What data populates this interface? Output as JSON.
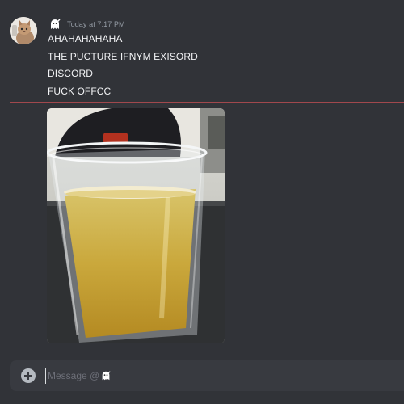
{
  "message": {
    "author_icon": "ghost-emoji-icon",
    "timestamp": "Today at 7:17 PM",
    "lines": [
      "AHAHAHAHAHA",
      "THE PUCTURE IFNYM EXISORD",
      "DISCORD",
      "FUCK OFFCC"
    ],
    "avatar_icon": "cat-avatar-icon",
    "attachment_icon": "beer-cup-photo"
  },
  "divider": {
    "color": "#a1484d"
  },
  "composer": {
    "placeholder": "Message @",
    "recipient_icon": "ghost-emoji-icon",
    "add_icon": "plus-circle-icon"
  },
  "colors": {
    "background": "#313338",
    "composer_bg": "#383a40",
    "text": "#f2f3f5",
    "muted": "#949ba4"
  }
}
